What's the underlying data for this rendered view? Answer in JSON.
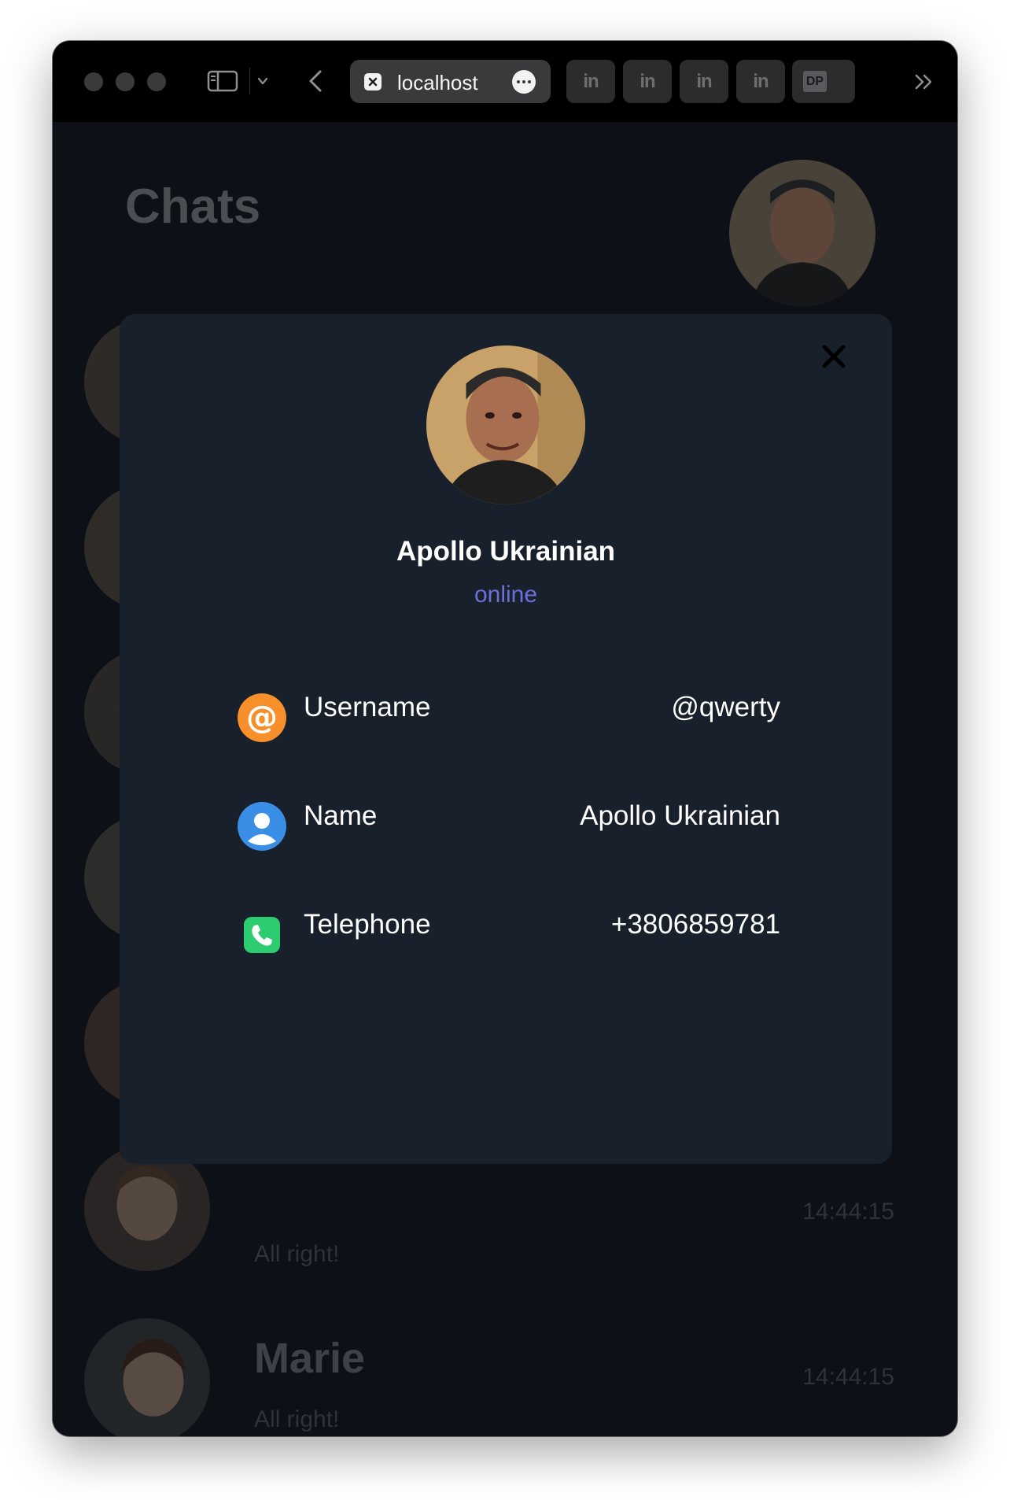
{
  "browser": {
    "url": "localhost",
    "tabs": [
      "in",
      "in",
      "in",
      "in"
    ],
    "pinned_tab": "DP"
  },
  "app": {
    "title": "Chats",
    "chats": [
      {
        "name": "",
        "message": "",
        "time": ""
      },
      {
        "name": "",
        "message": "",
        "time": ""
      },
      {
        "name": "",
        "message": "",
        "time": ""
      },
      {
        "name": "",
        "message": "",
        "time": ""
      },
      {
        "name": "",
        "message": "",
        "time": ""
      },
      {
        "name": "",
        "message": "All right!",
        "time": "14:44:15"
      },
      {
        "name": "Marie",
        "message": "All right!",
        "time": "14:44:15"
      }
    ]
  },
  "profile": {
    "name": "Apollo Ukrainian",
    "status": "online",
    "fields": [
      {
        "label": "Username",
        "value": "@qwerty",
        "icon": "at-icon",
        "color": "#f7902b"
      },
      {
        "label": "Name",
        "value": "Apollo Ukrainian",
        "icon": "user-icon",
        "color": "#3a8ee6"
      },
      {
        "label": "Telephone",
        "value": "+3806859781",
        "icon": "phone-icon",
        "color": "#2ecc71"
      }
    ]
  },
  "colors": {
    "accent_status": "#6b70d9",
    "modal_bg": "#18202b",
    "app_bg": "#0d1117"
  }
}
